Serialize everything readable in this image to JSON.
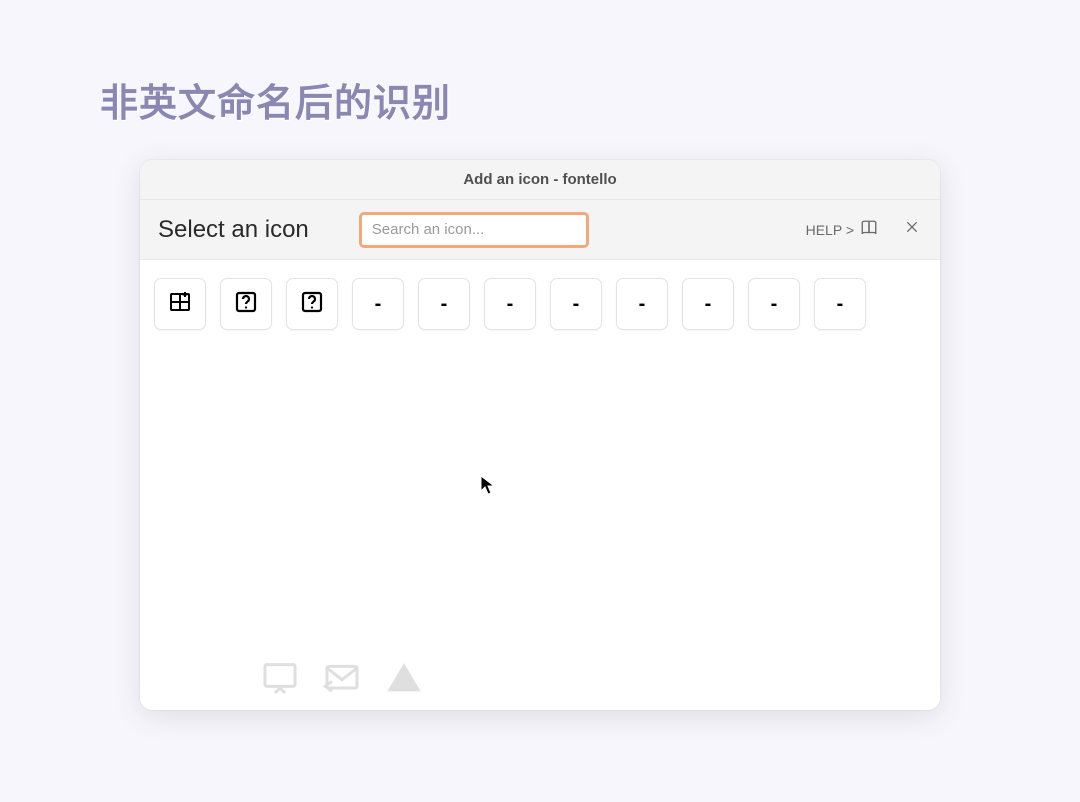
{
  "page": {
    "title_cn": "非英文命名后的识别"
  },
  "dialog": {
    "window_title": "Add an icon - fontello",
    "select_label": "Select an icon",
    "search_placeholder": "Search an icon...",
    "help_label": "HELP >",
    "icons": [
      {
        "name": "table-add-icon",
        "type": "svg-table"
      },
      {
        "name": "unknown-icon-1",
        "type": "svg-question"
      },
      {
        "name": "unknown-icon-2",
        "type": "svg-question"
      },
      {
        "name": "placeholder-1",
        "type": "dash",
        "label": "-"
      },
      {
        "name": "placeholder-2",
        "type": "dash",
        "label": "-"
      },
      {
        "name": "placeholder-3",
        "type": "dash",
        "label": "-"
      },
      {
        "name": "placeholder-4",
        "type": "dash",
        "label": "-"
      },
      {
        "name": "placeholder-5",
        "type": "dash",
        "label": "-"
      },
      {
        "name": "placeholder-6",
        "type": "dash",
        "label": "-"
      },
      {
        "name": "placeholder-7",
        "type": "dash",
        "label": "-"
      },
      {
        "name": "placeholder-8",
        "type": "dash",
        "label": "-"
      }
    ]
  }
}
